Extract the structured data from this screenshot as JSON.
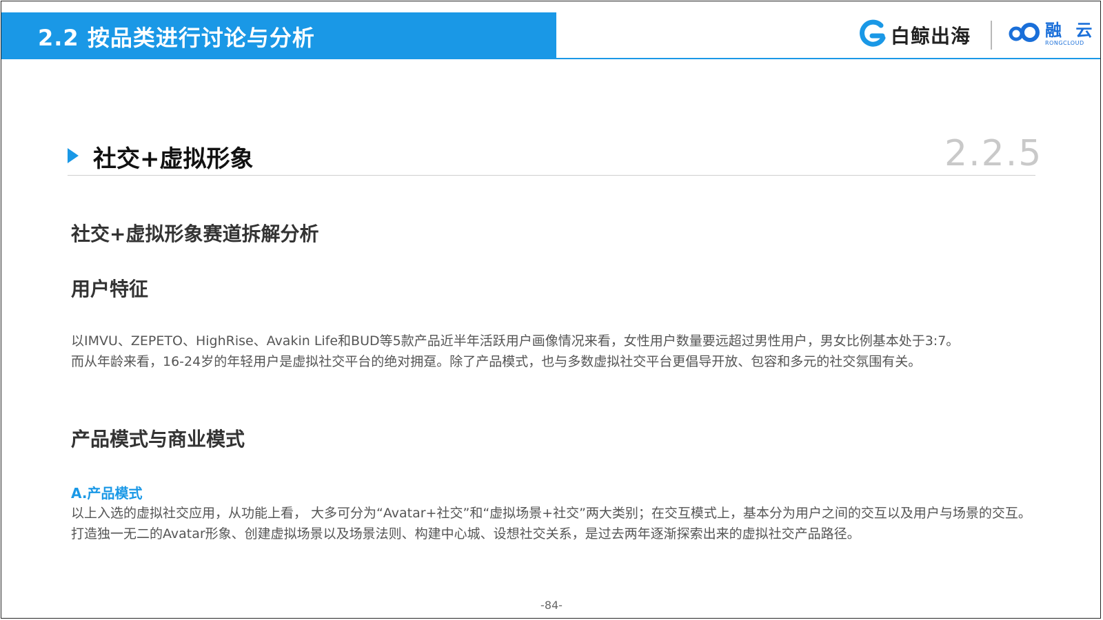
{
  "header": {
    "title": "2.2 按品类进行讨论与分析",
    "accent_color": "#1a98e6",
    "logo_baijing": {
      "icon": "baijing-g-logo-icon",
      "text": "白鲸出海"
    },
    "logo_rongcloud": {
      "icon": "rongcloud-infinity-logo-icon",
      "text_cn": "融 云",
      "text_en": "RONGCLOUD"
    }
  },
  "section": {
    "marker_icon": "triangle-right-icon",
    "title": "社交+虚拟形象",
    "number": "2.2.5"
  },
  "content": {
    "heading_main": "社交+虚拟形象赛道拆解分析",
    "heading_user": "用户特征",
    "user_paragraphs": [
      "以IMVU、ZEPETO、HighRise、Avakin Life和BUD等5款产品近半年活跃用户画像情况来看，女性用户数量要远超过男性用户，男女比例基本处于3:7。",
      "而从年龄来看，16-24岁的年轻用户是虚拟社交平台的绝对拥趸。除了产品模式，也与多数虚拟社交平台更倡导开放、包容和多元的社交氛围有关。"
    ],
    "heading_product": "产品模式与商业模式",
    "sub_heading_a": "A.产品模式",
    "product_paragraph": "以上入选的虚拟社交应用，从功能上看， 大多可分为“Avatar+社交”和“虚拟场景+社交”两大类别；在交互模式上，基本分为用户之间的交互以及用户与场景的交互。打造独一无二的Avatar形象、创建虚拟场景以及场景法则、构建中心城、设想社交关系，是过去两年逐渐探索出来的虚拟社交产品路径。"
  },
  "footer": {
    "page_number": "-84-"
  }
}
